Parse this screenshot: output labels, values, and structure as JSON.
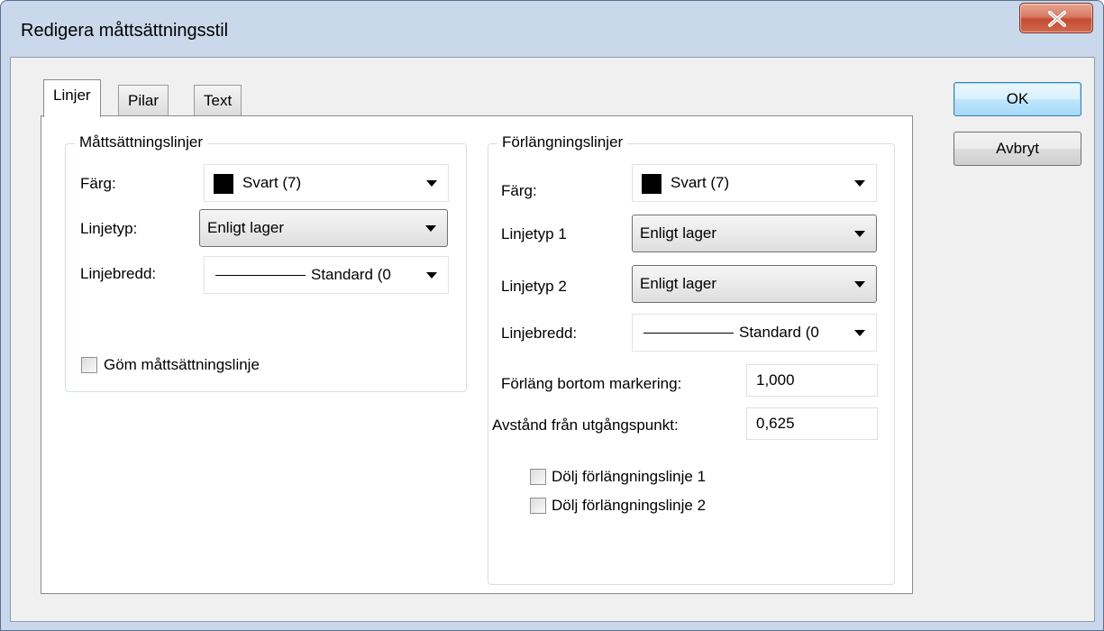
{
  "window": {
    "title": "Redigera måttsättningsstil"
  },
  "icons": {
    "close": "close-icon",
    "dropdown": "chevron-down-icon"
  },
  "tabs": [
    {
      "label": "Linjer",
      "active": true
    },
    {
      "label": "Pilar",
      "active": false
    },
    {
      "label": "Text",
      "active": false
    }
  ],
  "dimension_lines": {
    "title": "Måttsättningslinjer",
    "color_label": "Färg:",
    "color_value": "Svart (7)",
    "linetype_label": "Linjetyp:",
    "linetype_value": "Enligt lager",
    "lineweight_label": "Linjebredd:",
    "lineweight_value": "Standard (0",
    "hide_label": "Göm måttsättningslinje",
    "hide_checked": false
  },
  "extension_lines": {
    "title": "Förlängningslinjer",
    "color_label": "Färg:",
    "color_value": "Svart (7)",
    "linetype1_label": "Linjetyp 1",
    "linetype1_value": "Enligt lager",
    "linetype2_label": "Linjetyp 2",
    "linetype2_value": "Enligt lager",
    "lineweight_label": "Linjebredd:",
    "lineweight_value": "Standard (0",
    "extend_label": "Förläng bortom markering:",
    "extend_value": "1,000",
    "offset_label": "Avstånd från utgångspunkt:",
    "offset_value": "0,625",
    "hide1_label": "Dölj förlängningslinje 1",
    "hide1_checked": false,
    "hide2_label": "Dölj förlängningslinje 2",
    "hide2_checked": false
  },
  "buttons": {
    "ok": "OK",
    "cancel": "Avbryt"
  },
  "colors": {
    "swatch": "#000000",
    "close_button": "#c44b30",
    "title_bar": "#c9d8eb"
  }
}
